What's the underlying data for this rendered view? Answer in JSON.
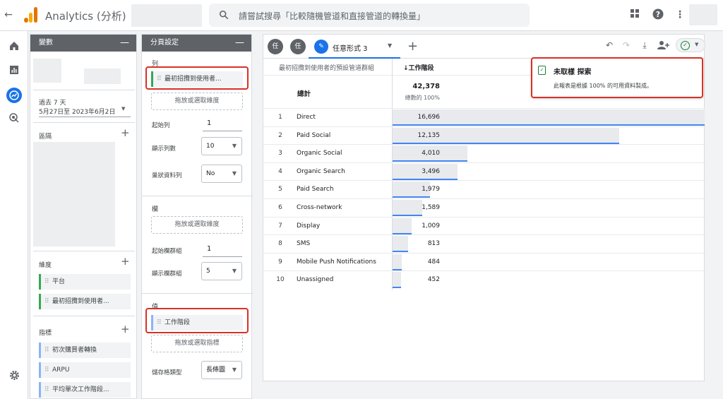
{
  "app": {
    "title": "Analytics (分析)"
  },
  "search": {
    "placeholder": "請嘗試搜尋「比較隨機管道和直接管道的轉換量」"
  },
  "variables": {
    "header": "變數",
    "date": {
      "title": "過去 7 天",
      "range": "5月27日至 2023年6月2日"
    },
    "segments_label": "區隔",
    "dimensions_label": "維度",
    "dimensions": [
      "平台",
      "最初招攬到使用者..."
    ],
    "metrics_label": "指標",
    "metrics": [
      "初次購買者轉換",
      "ARPU",
      "平均單次工作階段..."
    ]
  },
  "settings": {
    "header": "分頁設定",
    "rows_label": "列",
    "rows_chip": "最初招攬到使用者...",
    "rows_drop": "拖放或選取維度",
    "start_row_label": "起始列",
    "start_row": "1",
    "show_rows_label": "顯示列數",
    "show_rows": "10",
    "nested_rows_label": "巢狀資料列",
    "nested_rows": "No",
    "cols_label": "欄",
    "cols_drop": "拖放或選取維度",
    "start_col_label": "起始欄群組",
    "start_col": "1",
    "show_cols_label": "顯示欄群組",
    "show_cols": "5",
    "values_label": "值",
    "values_chip": "工作階段",
    "values_drop": "拖放或選取指標",
    "cell_type_label": "儲存格類型",
    "cell_type": "長條圖"
  },
  "canvas": {
    "tab_btn_1": "任",
    "tab_btn_2": "任",
    "tab_label": "任意形式 3",
    "dim_header": "最初招攬到使用者的預設管道群組",
    "metric_header": "↓工作階段",
    "total_label": "總計",
    "total_value": "42,378",
    "total_pct": "總數的 100%",
    "rows": [
      {
        "idx": "1",
        "name": "Direct",
        "value": "16,696",
        "share": 1.0
      },
      {
        "idx": "2",
        "name": "Paid Social",
        "value": "12,135",
        "share": 0.727
      },
      {
        "idx": "3",
        "name": "Organic Social",
        "value": "4,010",
        "share": 0.24
      },
      {
        "idx": "4",
        "name": "Organic Search",
        "value": "3,496",
        "share": 0.209
      },
      {
        "idx": "5",
        "name": "Paid Search",
        "value": "1,979",
        "share": 0.119
      },
      {
        "idx": "6",
        "name": "Cross-network",
        "value": "1,589",
        "share": 0.095
      },
      {
        "idx": "7",
        "name": "Display",
        "value": "1,009",
        "share": 0.06
      },
      {
        "idx": "8",
        "name": "SMS",
        "value": "813",
        "share": 0.049
      },
      {
        "idx": "9",
        "name": "Mobile Push Notifications",
        "value": "484",
        "share": 0.029
      },
      {
        "idx": "10",
        "name": "Unassigned",
        "value": "452",
        "share": 0.027
      }
    ]
  },
  "popover": {
    "title": "未取樣 探索",
    "desc": "此報表是根據 100% 的可用資料製成。"
  },
  "colors": {
    "accent": "#1a73e8",
    "highlight": "#d93025",
    "success": "#188038"
  }
}
